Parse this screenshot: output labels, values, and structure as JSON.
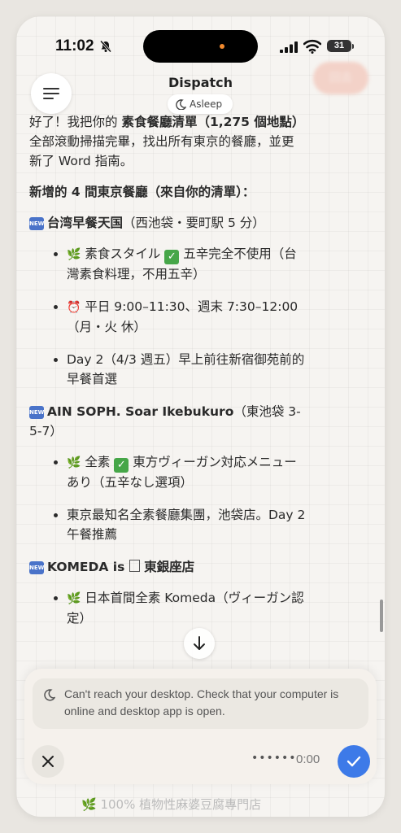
{
  "status_bar": {
    "time": "11:02",
    "battery": "31"
  },
  "header": {
    "title": "Dispatch",
    "status": "Asleep",
    "blurred_action": "回去"
  },
  "message": {
    "intro_lead": "好了！我把你的 ",
    "intro_bold": "素食餐廳清單（1,275 個地點）",
    "intro_rest": " 全部滾動掃描完畢，找出所有東京的餐廳，並更新了 Word 指南。",
    "section_heading": "新增的 4 間東京餐廳（來自你的清單）：",
    "new_badge": "NEW",
    "restaurants": [
      {
        "name": "台湾早餐天国",
        "location": "（西池袋・要町駅 5 分）",
        "bullets": [
          {
            "emoji": "🌿",
            "lead": " 素食スタイル ",
            "check": "✓",
            "text": " 五辛完全不使用（台灣素食料理，不用五辛）"
          },
          {
            "emoji": "⏰",
            "lead": "",
            "check": "",
            "text": " 平日 9:00–11:30、週末 7:30–12:00（月・火 休）"
          },
          {
            "emoji": "",
            "lead": "",
            "check": "",
            "text": "Day 2（4/3 週五）早上前往新宿御苑前的早餐首選"
          }
        ]
      },
      {
        "name": "AIN SOPH. Soar Ikebukuro",
        "location": "（東池袋 3-5-7）",
        "bullets": [
          {
            "emoji": "🌿",
            "lead": " 全素 ",
            "check": "✓",
            "text": " 東方ヴィーガン対応メニューあり（五辛なし選項）"
          },
          {
            "emoji": "",
            "lead": "",
            "check": "",
            "text": "東京最知名全素餐廳集團，池袋店。Day 2 午餐推薦"
          }
        ]
      },
      {
        "name_before": "KOMEDA is ",
        "name_after": " 東銀座店",
        "bullets": [
          {
            "emoji": "🌿",
            "lead": "",
            "check": "",
            "text": " 日本首間全素 Komeda（ヴィーガン認定）"
          }
        ]
      }
    ]
  },
  "notice": {
    "text": "Can't reach your desktop. Check that your computer is online and desktop app is open."
  },
  "recorder": {
    "dots": "••••••",
    "timer": "0:00"
  },
  "below_panel": "🌿 100% 植物性麻婆豆腐專門店"
}
